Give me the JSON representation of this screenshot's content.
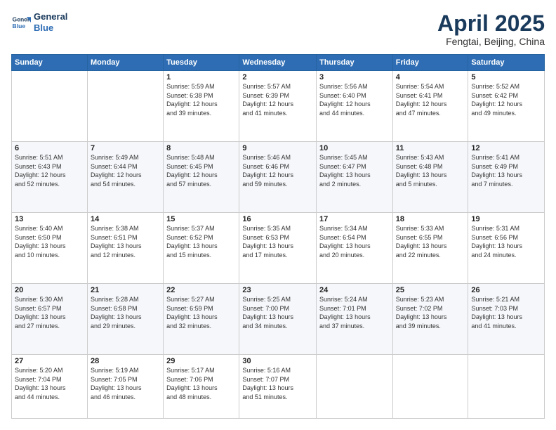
{
  "logo": {
    "line1": "General",
    "line2": "Blue"
  },
  "title": {
    "main": "April 2025",
    "sub": "Fengtai, Beijing, China"
  },
  "headers": [
    "Sunday",
    "Monday",
    "Tuesday",
    "Wednesday",
    "Thursday",
    "Friday",
    "Saturday"
  ],
  "weeks": [
    [
      {
        "day": "",
        "detail": ""
      },
      {
        "day": "",
        "detail": ""
      },
      {
        "day": "1",
        "detail": "Sunrise: 5:59 AM\nSunset: 6:38 PM\nDaylight: 12 hours\nand 39 minutes."
      },
      {
        "day": "2",
        "detail": "Sunrise: 5:57 AM\nSunset: 6:39 PM\nDaylight: 12 hours\nand 41 minutes."
      },
      {
        "day": "3",
        "detail": "Sunrise: 5:56 AM\nSunset: 6:40 PM\nDaylight: 12 hours\nand 44 minutes."
      },
      {
        "day": "4",
        "detail": "Sunrise: 5:54 AM\nSunset: 6:41 PM\nDaylight: 12 hours\nand 47 minutes."
      },
      {
        "day": "5",
        "detail": "Sunrise: 5:52 AM\nSunset: 6:42 PM\nDaylight: 12 hours\nand 49 minutes."
      }
    ],
    [
      {
        "day": "6",
        "detail": "Sunrise: 5:51 AM\nSunset: 6:43 PM\nDaylight: 12 hours\nand 52 minutes."
      },
      {
        "day": "7",
        "detail": "Sunrise: 5:49 AM\nSunset: 6:44 PM\nDaylight: 12 hours\nand 54 minutes."
      },
      {
        "day": "8",
        "detail": "Sunrise: 5:48 AM\nSunset: 6:45 PM\nDaylight: 12 hours\nand 57 minutes."
      },
      {
        "day": "9",
        "detail": "Sunrise: 5:46 AM\nSunset: 6:46 PM\nDaylight: 12 hours\nand 59 minutes."
      },
      {
        "day": "10",
        "detail": "Sunrise: 5:45 AM\nSunset: 6:47 PM\nDaylight: 13 hours\nand 2 minutes."
      },
      {
        "day": "11",
        "detail": "Sunrise: 5:43 AM\nSunset: 6:48 PM\nDaylight: 13 hours\nand 5 minutes."
      },
      {
        "day": "12",
        "detail": "Sunrise: 5:41 AM\nSunset: 6:49 PM\nDaylight: 13 hours\nand 7 minutes."
      }
    ],
    [
      {
        "day": "13",
        "detail": "Sunrise: 5:40 AM\nSunset: 6:50 PM\nDaylight: 13 hours\nand 10 minutes."
      },
      {
        "day": "14",
        "detail": "Sunrise: 5:38 AM\nSunset: 6:51 PM\nDaylight: 13 hours\nand 12 minutes."
      },
      {
        "day": "15",
        "detail": "Sunrise: 5:37 AM\nSunset: 6:52 PM\nDaylight: 13 hours\nand 15 minutes."
      },
      {
        "day": "16",
        "detail": "Sunrise: 5:35 AM\nSunset: 6:53 PM\nDaylight: 13 hours\nand 17 minutes."
      },
      {
        "day": "17",
        "detail": "Sunrise: 5:34 AM\nSunset: 6:54 PM\nDaylight: 13 hours\nand 20 minutes."
      },
      {
        "day": "18",
        "detail": "Sunrise: 5:33 AM\nSunset: 6:55 PM\nDaylight: 13 hours\nand 22 minutes."
      },
      {
        "day": "19",
        "detail": "Sunrise: 5:31 AM\nSunset: 6:56 PM\nDaylight: 13 hours\nand 24 minutes."
      }
    ],
    [
      {
        "day": "20",
        "detail": "Sunrise: 5:30 AM\nSunset: 6:57 PM\nDaylight: 13 hours\nand 27 minutes."
      },
      {
        "day": "21",
        "detail": "Sunrise: 5:28 AM\nSunset: 6:58 PM\nDaylight: 13 hours\nand 29 minutes."
      },
      {
        "day": "22",
        "detail": "Sunrise: 5:27 AM\nSunset: 6:59 PM\nDaylight: 13 hours\nand 32 minutes."
      },
      {
        "day": "23",
        "detail": "Sunrise: 5:25 AM\nSunset: 7:00 PM\nDaylight: 13 hours\nand 34 minutes."
      },
      {
        "day": "24",
        "detail": "Sunrise: 5:24 AM\nSunset: 7:01 PM\nDaylight: 13 hours\nand 37 minutes."
      },
      {
        "day": "25",
        "detail": "Sunrise: 5:23 AM\nSunset: 7:02 PM\nDaylight: 13 hours\nand 39 minutes."
      },
      {
        "day": "26",
        "detail": "Sunrise: 5:21 AM\nSunset: 7:03 PM\nDaylight: 13 hours\nand 41 minutes."
      }
    ],
    [
      {
        "day": "27",
        "detail": "Sunrise: 5:20 AM\nSunset: 7:04 PM\nDaylight: 13 hours\nand 44 minutes."
      },
      {
        "day": "28",
        "detail": "Sunrise: 5:19 AM\nSunset: 7:05 PM\nDaylight: 13 hours\nand 46 minutes."
      },
      {
        "day": "29",
        "detail": "Sunrise: 5:17 AM\nSunset: 7:06 PM\nDaylight: 13 hours\nand 48 minutes."
      },
      {
        "day": "30",
        "detail": "Sunrise: 5:16 AM\nSunset: 7:07 PM\nDaylight: 13 hours\nand 51 minutes."
      },
      {
        "day": "",
        "detail": ""
      },
      {
        "day": "",
        "detail": ""
      },
      {
        "day": "",
        "detail": ""
      }
    ]
  ]
}
